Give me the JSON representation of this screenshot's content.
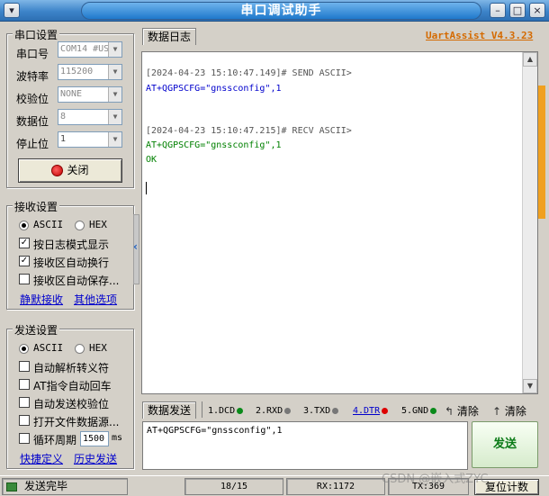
{
  "window": {
    "title": "串口调试助手"
  },
  "serial_settings": {
    "title": "串口设置",
    "port": {
      "label": "串口号",
      "value": "COM14 #US"
    },
    "baud": {
      "label": "波特率",
      "value": "115200"
    },
    "parity": {
      "label": "校验位",
      "value": "NONE"
    },
    "databits": {
      "label": "数据位",
      "value": "8"
    },
    "stopbits": {
      "label": "停止位",
      "value": "1"
    },
    "close_button": "关闭"
  },
  "recv_settings": {
    "title": "接收设置",
    "ascii": "ASCII",
    "hex": "HEX",
    "opt_log_mode": "按日志模式显示",
    "opt_auto_wrap": "接收区自动换行",
    "opt_auto_save": "接收区自动保存...",
    "link_mute": "静默接收",
    "link_other": "其他选项"
  },
  "send_settings": {
    "title": "发送设置",
    "ascii": "ASCII",
    "hex": "HEX",
    "opt_escape": "自动解析转义符",
    "opt_at_cr": "AT指令自动回车",
    "opt_checksum": "自动发送校验位",
    "opt_file": "打开文件数据源...",
    "opt_loop": "循环周期",
    "loop_value": "1500",
    "loop_unit": "ms",
    "link_shortcut": "快捷定义",
    "link_history": "历史发送"
  },
  "log": {
    "tab": "数据日志",
    "brand": "UartAssist V4.3.23",
    "lines": [
      "[2024-04-23 15:10:47.149]# SEND ASCII>",
      "AT+QGPSCFG=\"gnssconfig\",1",
      "[2024-04-23 15:10:47.215]# RECV ASCII>",
      "AT+QGPSCFG=\"gnssconfig\",1",
      "OK"
    ]
  },
  "send_area": {
    "tab": "数据发送",
    "dcd": "1.DCD",
    "rxd": "2.RXD",
    "txd": "3.TXD",
    "dtr": "4.DTR",
    "gnd": "5.GND",
    "clear1": "清除",
    "clear2": "清除",
    "input_value": "AT+QGPSCFG=\"gnssconfig\",1",
    "send_button": "发送"
  },
  "status": {
    "message": "发送完毕",
    "count": "18/15",
    "rx": "RX:1172",
    "tx": "TX:369",
    "reset": "复位计数",
    "watermark": "CSDN @嵌入式ZYC"
  },
  "colors": {
    "send_text": "#0000cc",
    "recv_text": "#008000",
    "brand": "#d46a00",
    "accent": "#f0a020"
  }
}
